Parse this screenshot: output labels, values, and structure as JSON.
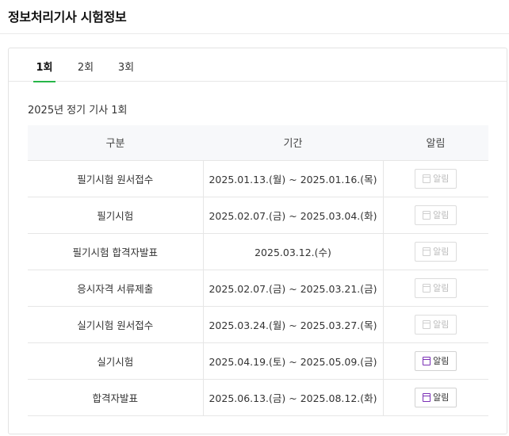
{
  "page": {
    "title": "정보처리기사 시험정보"
  },
  "tabs": [
    {
      "label": "1회",
      "active": true
    },
    {
      "label": "2회",
      "active": false
    },
    {
      "label": "3회",
      "active": false
    }
  ],
  "section": {
    "title": "2025년 정기 기사 1회"
  },
  "table": {
    "headers": [
      "구분",
      "기간",
      "알림"
    ],
    "rows": [
      {
        "category": "필기시험 원서접수",
        "period": "2025.01.13.(월) ~ 2025.01.16.(목)",
        "alarm_label": "알림",
        "alarm_enabled": false
      },
      {
        "category": "필기시험",
        "period": "2025.02.07.(금) ~ 2025.03.04.(화)",
        "alarm_label": "알림",
        "alarm_enabled": false
      },
      {
        "category": "필기시험 합격자발표",
        "period": "2025.03.12.(수)",
        "alarm_label": "알림",
        "alarm_enabled": false
      },
      {
        "category": "응시자격 서류제출",
        "period": "2025.02.07.(금) ~ 2025.03.21.(금)",
        "alarm_label": "알림",
        "alarm_enabled": false
      },
      {
        "category": "실기시험 원서접수",
        "period": "2025.03.24.(월) ~ 2025.03.27.(목)",
        "alarm_label": "알림",
        "alarm_enabled": false
      },
      {
        "category": "실기시험",
        "period": "2025.04.19.(토) ~ 2025.05.09.(금)",
        "alarm_label": "알림",
        "alarm_enabled": true
      },
      {
        "category": "합격자발표",
        "period": "2025.06.13.(금) ~ 2025.08.12.(화)",
        "alarm_label": "알림",
        "alarm_enabled": true
      }
    ]
  },
  "colors": {
    "accent_underline": "#27b648",
    "calendar_icon_active": "#7a2fb5"
  },
  "icons": {
    "alarm": "calendar-icon"
  }
}
